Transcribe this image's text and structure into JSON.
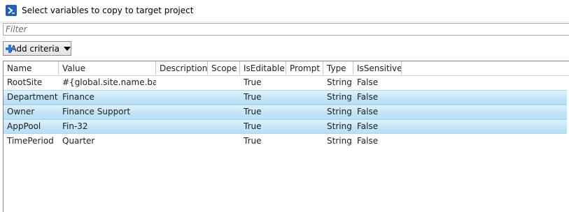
{
  "window": {
    "title": "Select variables to copy to target project"
  },
  "filter": {
    "placeholder": "Filter",
    "value": ""
  },
  "toolbar": {
    "add_criteria_label": "Add criteria"
  },
  "table": {
    "columns": [
      "Name",
      "Value",
      "Description",
      "Scope",
      "IsEditable",
      "Prompt",
      "Type",
      "IsSensitive"
    ],
    "rows": [
      {
        "selected": false,
        "cells": [
          "RootSite",
          "#{global.site.name.base}",
          "",
          "",
          "True",
          "",
          "String",
          "False"
        ]
      },
      {
        "selected": true,
        "cells": [
          "Department",
          "Finance",
          "",
          "",
          "True",
          "",
          "String",
          "False"
        ]
      },
      {
        "selected": true,
        "cells": [
          "Owner",
          "Finance Support",
          "",
          "",
          "True",
          "",
          "String",
          "False"
        ]
      },
      {
        "selected": true,
        "cells": [
          "AppPool",
          "Fin-32",
          "",
          "",
          "True",
          "",
          "String",
          "False"
        ]
      },
      {
        "selected": false,
        "cells": [
          "TimePeriod",
          "Quarter",
          "",
          "",
          "True",
          "",
          "String",
          "False"
        ]
      }
    ]
  },
  "colors": {
    "selection": "#c1e4f7",
    "selection_border": "#a9d8f3",
    "accent": "#2a78d2"
  }
}
